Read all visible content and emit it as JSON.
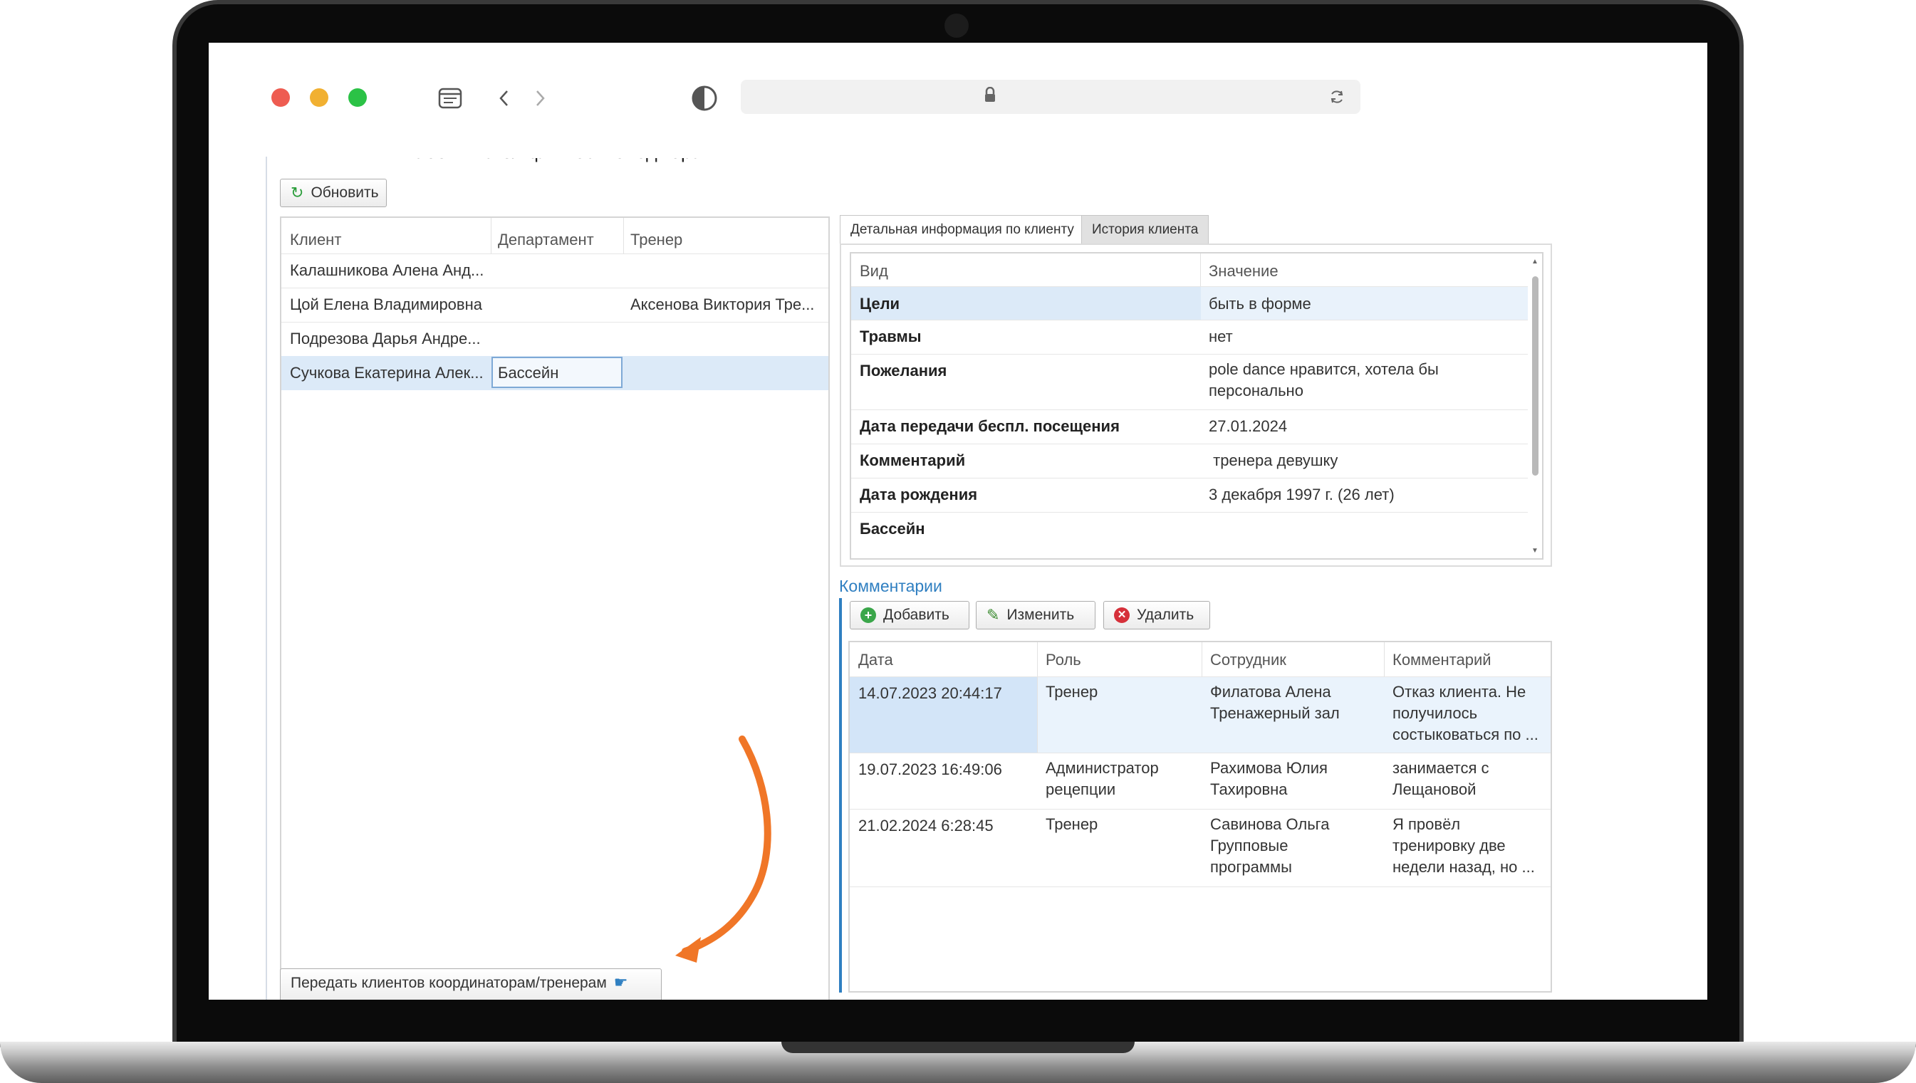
{
  "app": {
    "page_title": "Рабочий стол фитнес-менеджера",
    "refresh_label": "Обновить",
    "refresh_icon": "refresh-icon",
    "transfer_label": "Передать клиентов координаторам/тренерам"
  },
  "clients_table": {
    "headers": [
      "Клиент",
      "Департамент",
      "Тренер"
    ],
    "rows": [
      {
        "client": "Калашникова Алена Анд...",
        "department": "",
        "trainer": ""
      },
      {
        "client": "Цой Елена Владимировна",
        "department": "",
        "trainer": "Аксенова Виктория Тре..."
      },
      {
        "client": "Подрезова Дарья Андре...",
        "department": "",
        "trainer": ""
      },
      {
        "client": "Сучкова Екатерина Алек...",
        "department": "Бассейн",
        "trainer": ""
      }
    ]
  },
  "tabs": [
    "Детальная информация по клиенту",
    "История клиента"
  ],
  "details": {
    "headers": [
      "Вид",
      "Значение"
    ],
    "rows": [
      {
        "kind": "Цели",
        "value": "быть в форме"
      },
      {
        "kind": "Травмы",
        "value": "нет"
      },
      {
        "kind": "Пожелания",
        "value": "pole dance нравится, хотела бы персонально"
      },
      {
        "kind": "Дата передачи беспл. посещения",
        "value": "27.01.2024"
      },
      {
        "kind": "Комментарий",
        "value": " тренера девушку"
      },
      {
        "kind": "Дата рождения",
        "value": "3 декабря 1997 г. (26 лет)"
      },
      {
        "kind": "Бассейн",
        "value": ""
      }
    ]
  },
  "comments": {
    "title": "Комментарии",
    "add_label": "Добавить",
    "edit_label": "Изменить",
    "delete_label": "Удалить",
    "headers": [
      "Дата",
      "Роль",
      "Сотрудник",
      "Комментарий"
    ],
    "rows": [
      {
        "date": "14.07.2023 20:44:17",
        "role": "Тренер",
        "employee": "Филатова Алена Тренажерный зал",
        "comment": "Отказ клиента. Не получилось состыковаться по ..."
      },
      {
        "date": "19.07.2023 16:49:06",
        "role": "Администратор рецепции",
        "employee": "Рахимова Юлия Тахировна",
        "comment": "занимается с Лещановой"
      },
      {
        "date": "21.02.2024 6:28:45",
        "role": "Тренер",
        "employee": "Савинова Ольга Групповые программы",
        "comment": "Я провёл тренировку две недели назад, но ..."
      }
    ]
  },
  "colors": {
    "accent": "#2f7fc1",
    "selection": "#dceaf8",
    "arrow": "#f07627",
    "traffic_red": "#ee5c51",
    "traffic_yellow": "#f1b031",
    "traffic_green": "#2bc246"
  }
}
